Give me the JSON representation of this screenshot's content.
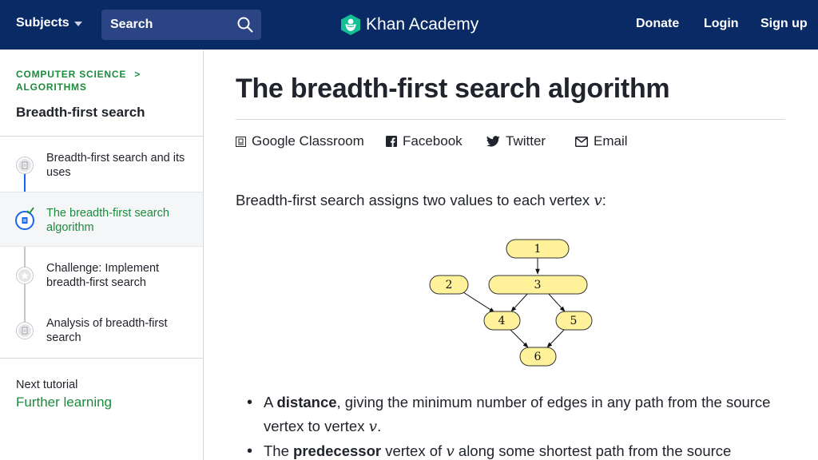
{
  "header": {
    "subjects_label": "Subjects",
    "search_label": "Search",
    "logo_text": "Khan Academy",
    "nav": {
      "donate": "Donate",
      "login": "Login",
      "signup": "Sign up"
    },
    "colors": {
      "bar": "#0a2a66",
      "search_bg": "#2b4584",
      "logo_green": "#14bf96"
    }
  },
  "sidebar": {
    "breadcrumb": {
      "course": "COMPUTER SCIENCE",
      "separator": ">",
      "unit": "ALGORITHMS"
    },
    "tutorial_title": "Breadth-first search",
    "items": [
      {
        "label": "Breadth-first search and its uses",
        "icon": "article-icon",
        "active": false
      },
      {
        "label": "The breadth-first search algorithm",
        "icon": "article-check-icon",
        "active": true
      },
      {
        "label": "Challenge: Implement breadth-first search",
        "icon": "star-icon",
        "active": false
      },
      {
        "label": "Analysis of breadth-first search",
        "icon": "article-icon",
        "active": false
      }
    ],
    "next_tutorial_label": "Next tutorial",
    "next_tutorial_link": "Further learning",
    "colors": {
      "active_green": "#1a8c3c",
      "progress_blue": "#1865f2"
    }
  },
  "article": {
    "title": "The breadth-first search algorithm",
    "share": {
      "classroom": "Google Classroom",
      "facebook": "Facebook",
      "twitter": "Twitter",
      "email": "Email"
    },
    "intro_text": "Breadth-first search assigns two values to each vertex ",
    "intro_var": "v",
    "intro_end": ":",
    "graph_nodes": [
      "1",
      "2",
      "3",
      "4",
      "5",
      "6"
    ],
    "bullets": [
      {
        "pre": "A ",
        "bold": "distance",
        "text": ", giving the minimum number of edges in any path from the source vertex to vertex ",
        "var": "v",
        "end": "."
      },
      {
        "pre": "The ",
        "bold": "predecessor",
        "text": " vertex of ",
        "var": "v",
        "end": " along some shortest path from the source"
      }
    ]
  }
}
